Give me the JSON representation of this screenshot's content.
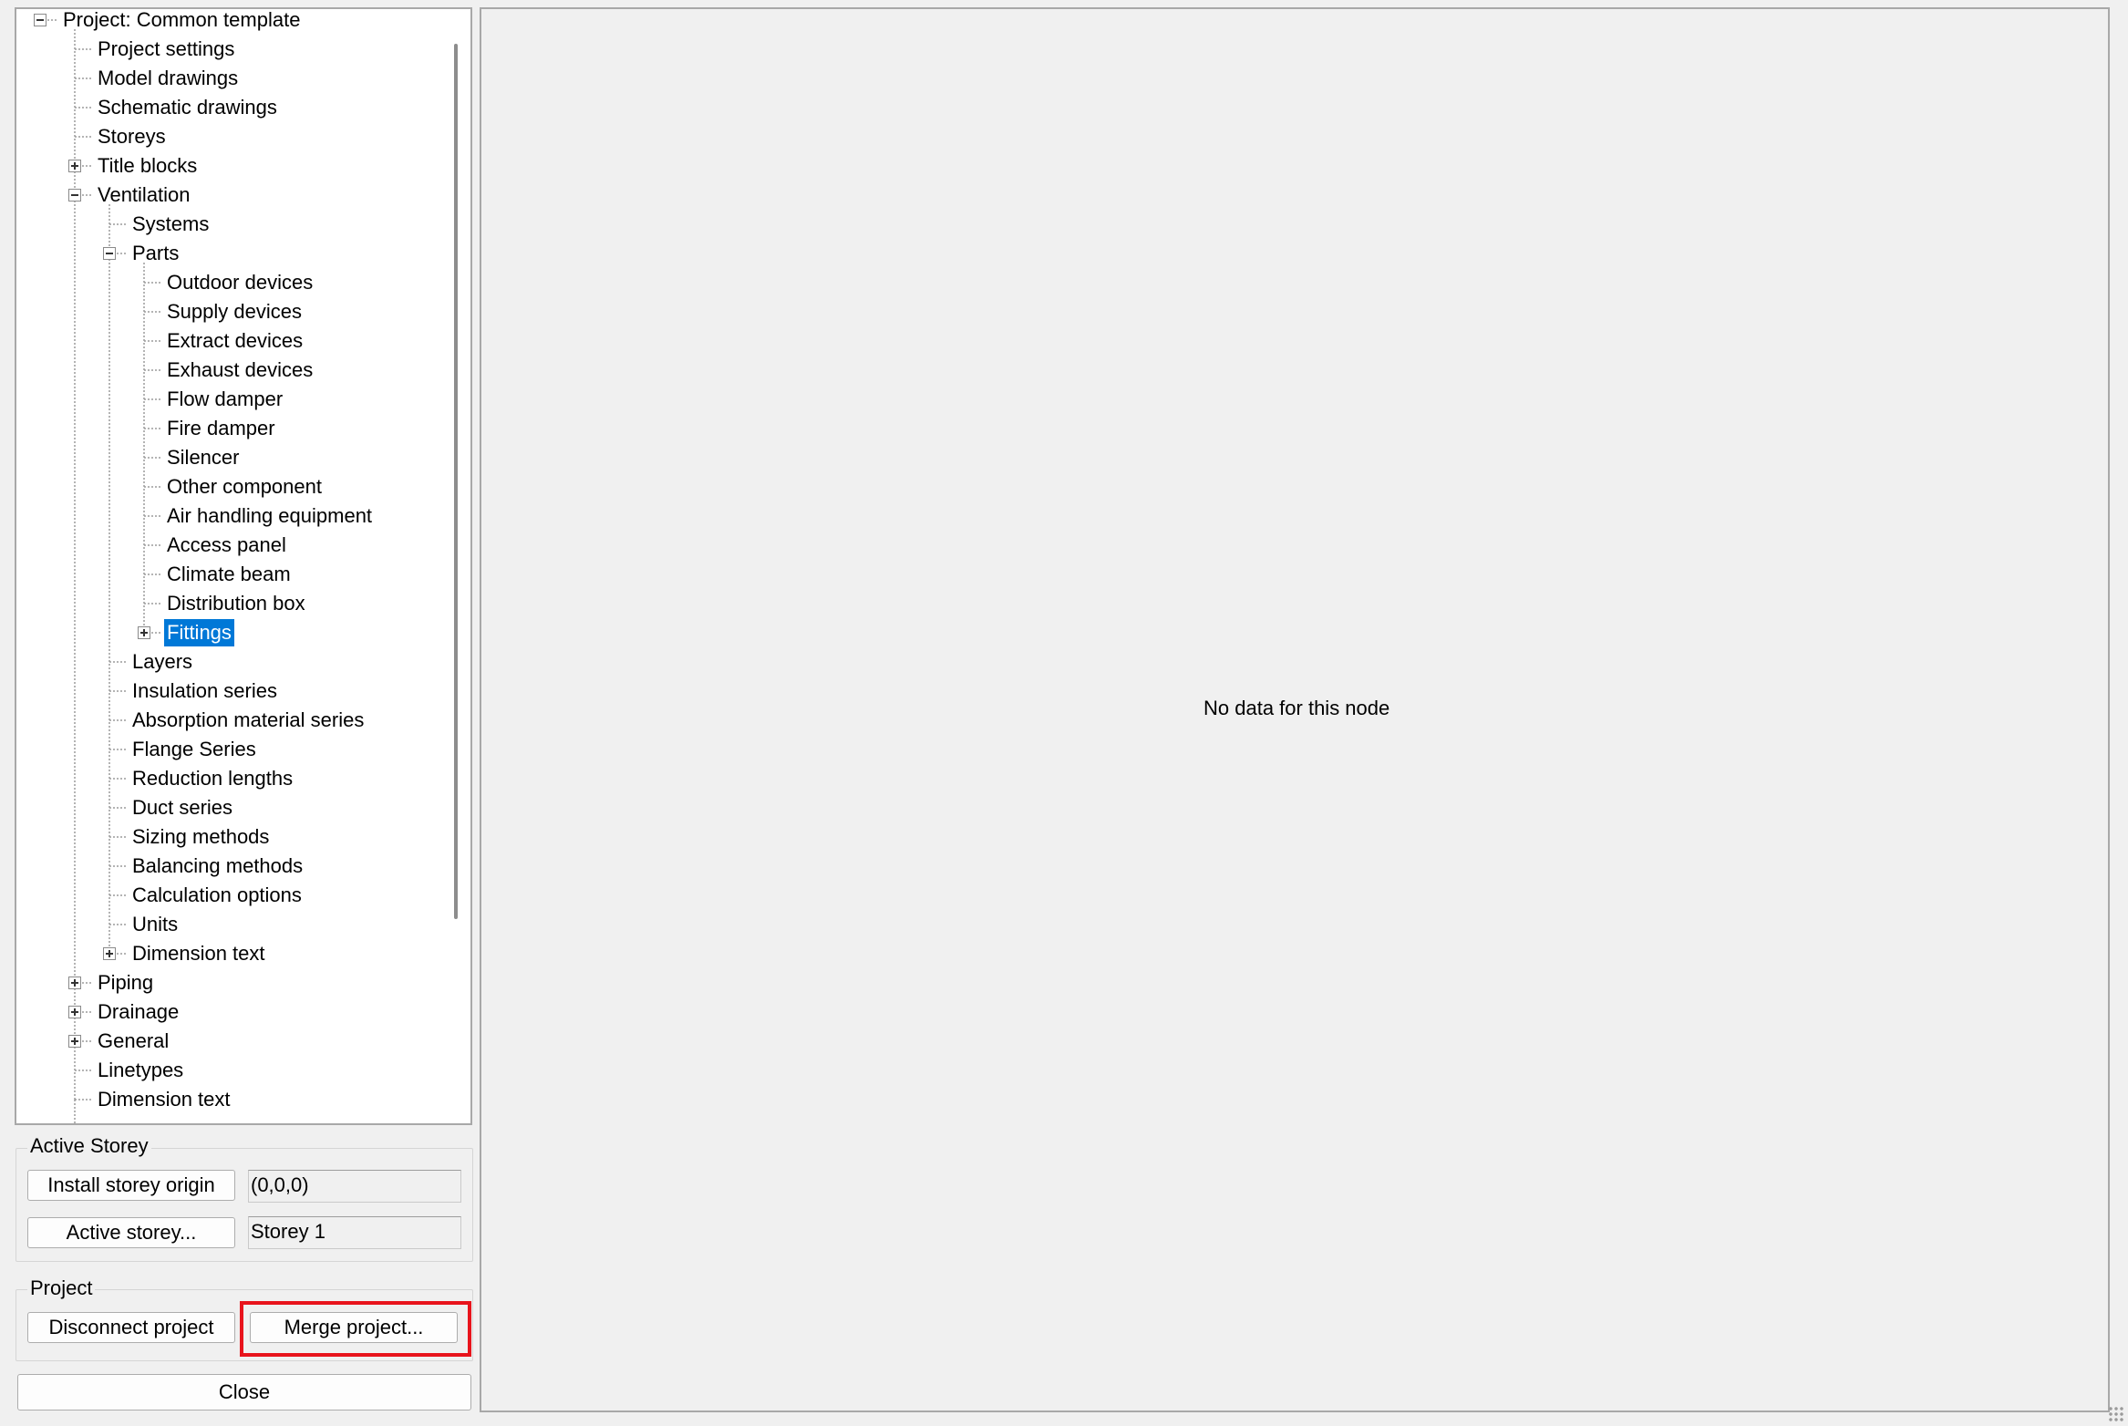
{
  "tree": {
    "nodes": [
      {
        "label": "Project: Common template",
        "level": 0,
        "toggle": "minus"
      },
      {
        "label": "Project settings",
        "level": 1,
        "toggle": null
      },
      {
        "label": "Model drawings",
        "level": 1,
        "toggle": null
      },
      {
        "label": "Schematic drawings",
        "level": 1,
        "toggle": null
      },
      {
        "label": "Storeys",
        "level": 1,
        "toggle": null
      },
      {
        "label": "Title blocks",
        "level": 1,
        "toggle": "plus"
      },
      {
        "label": "Ventilation",
        "level": 1,
        "toggle": "minus"
      },
      {
        "label": "Systems",
        "level": 2,
        "toggle": null
      },
      {
        "label": "Parts",
        "level": 2,
        "toggle": "minus"
      },
      {
        "label": "Outdoor devices",
        "level": 3,
        "toggle": null
      },
      {
        "label": "Supply devices",
        "level": 3,
        "toggle": null
      },
      {
        "label": "Extract devices",
        "level": 3,
        "toggle": null
      },
      {
        "label": "Exhaust devices",
        "level": 3,
        "toggle": null
      },
      {
        "label": "Flow damper",
        "level": 3,
        "toggle": null
      },
      {
        "label": "Fire damper",
        "level": 3,
        "toggle": null
      },
      {
        "label": "Silencer",
        "level": 3,
        "toggle": null
      },
      {
        "label": "Other component",
        "level": 3,
        "toggle": null
      },
      {
        "label": "Air handling equipment",
        "level": 3,
        "toggle": null
      },
      {
        "label": "Access panel",
        "level": 3,
        "toggle": null
      },
      {
        "label": "Climate beam",
        "level": 3,
        "toggle": null
      },
      {
        "label": "Distribution box",
        "level": 3,
        "toggle": null
      },
      {
        "label": "Fittings",
        "level": 3,
        "toggle": "plus",
        "selected": true
      },
      {
        "label": "Layers",
        "level": 2,
        "toggle": null
      },
      {
        "label": "Insulation series",
        "level": 2,
        "toggle": null
      },
      {
        "label": "Absorption material series",
        "level": 2,
        "toggle": null
      },
      {
        "label": "Flange Series",
        "level": 2,
        "toggle": null
      },
      {
        "label": "Reduction lengths",
        "level": 2,
        "toggle": null
      },
      {
        "label": "Duct series",
        "level": 2,
        "toggle": null
      },
      {
        "label": "Sizing methods",
        "level": 2,
        "toggle": null
      },
      {
        "label": "Balancing methods",
        "level": 2,
        "toggle": null
      },
      {
        "label": "Calculation options",
        "level": 2,
        "toggle": null
      },
      {
        "label": "Units",
        "level": 2,
        "toggle": null
      },
      {
        "label": "Dimension text",
        "level": 2,
        "toggle": "plus"
      },
      {
        "label": "Piping",
        "level": 1,
        "toggle": "plus"
      },
      {
        "label": "Drainage",
        "level": 1,
        "toggle": "plus"
      },
      {
        "label": "General",
        "level": 1,
        "toggle": "plus"
      },
      {
        "label": "Linetypes",
        "level": 1,
        "toggle": null
      },
      {
        "label": "Dimension text",
        "level": 1,
        "toggle": null
      }
    ]
  },
  "active_storey": {
    "title": "Active Storey",
    "install_origin_label": "Install storey origin",
    "origin_value": "(0,0,0)",
    "active_storey_label": "Active storey...",
    "storey_value": "Storey 1"
  },
  "project": {
    "title": "Project",
    "disconnect_label": "Disconnect project",
    "merge_label": "Merge project..."
  },
  "close_label": "Close",
  "content": {
    "message": "No data for this node"
  },
  "colors": {
    "selection": "#0078d7",
    "highlight": "#e8141c"
  }
}
